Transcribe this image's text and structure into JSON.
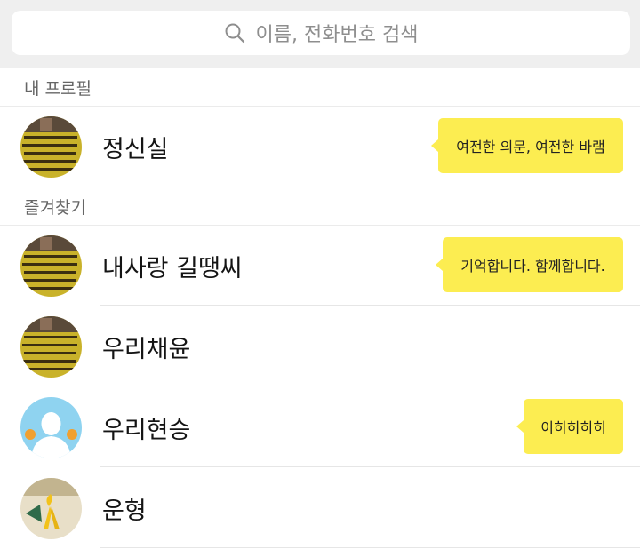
{
  "search": {
    "placeholder": "이름, 전화번호 검색",
    "icon": "search-icon"
  },
  "sections": {
    "my_profile": "내 프로필",
    "favorites": "즐겨찾기"
  },
  "my_profile": {
    "name": "정신실",
    "status": "여전한 의문, 여전한 바램",
    "avatar": "yellow-banner-photo"
  },
  "favorites": [
    {
      "name": "내사랑 길땡씨",
      "status": "기억합니다. 함께합니다.",
      "avatar": "yellow-banner-photo"
    },
    {
      "name": "우리채윤",
      "status": "",
      "avatar": "yellow-banner-photo"
    },
    {
      "name": "우리현승",
      "status": "이히히히히",
      "avatar": "person-silhouette-sky"
    },
    {
      "name": "운형",
      "status": "",
      "avatar": "yellow-ribbon-photo"
    }
  ],
  "colors": {
    "bubble": "#fced51",
    "search_bg": "#efefef",
    "avatar_banner": "#c9b22a",
    "avatar_sky": "#8fd3f0"
  }
}
